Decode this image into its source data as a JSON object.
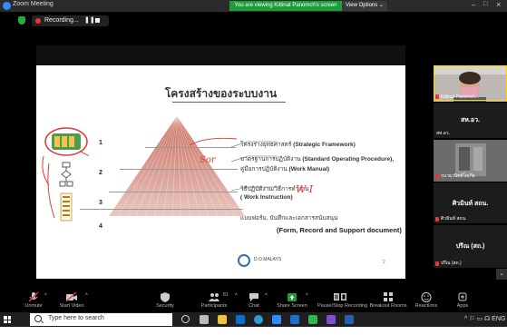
{
  "window": {
    "title": "Zoom Meeting",
    "share_banner": "You are viewing Kittinat Panomch's screen",
    "view_options": "View Options ⌄"
  },
  "recording": {
    "label": "Recording...",
    "pause": "❚❚",
    "stop": "■"
  },
  "slide": {
    "title": "โครงสร้างของระบบงาน",
    "levels": [
      "1",
      "2",
      "3",
      "4"
    ],
    "items": [
      {
        "thai": "โครงร่างยุทธศาสตร์ ",
        "en": "(Strategic Framework)"
      },
      {
        "thai": "มาตรฐานการปฏิบัติงาน ",
        "en": "(Standard Operating Procedure),"
      },
      {
        "thai": "คู่มือการปฏิบัติงาน ",
        "en": "(Work Manual)"
      },
      {
        "thai": "วิธีปฏิบัติงาน/วิธีการทำงาน",
        "en": ""
      },
      {
        "thai": "",
        "en": "( Work Instruction)"
      },
      {
        "thai": "แบบฟอร์ม, บันทึกและเอกสารสนับสนุน",
        "en": ""
      }
    ],
    "doc_line": "(Form, Record and Support document)",
    "annotations": [
      "Sor",
      "W I"
    ],
    "logo_text": "D.O.MALAYS",
    "page": "2"
  },
  "gallery": {
    "tiles": [
      {
        "type": "video",
        "label": "Kittinat Panomch...",
        "active": true,
        "muted": true
      },
      {
        "type": "name",
        "name": "สห.อว.",
        "label": "สห.อว."
      },
      {
        "type": "video",
        "label": "รนาธุวนิตย์โอเกีย",
        "muted": true
      },
      {
        "type": "name",
        "name": "ศิวมินท์ สถน.",
        "label": "ศิวมินท์ สถน.",
        "muted": true
      },
      {
        "type": "name",
        "name": "ปรีณ (สถ.)",
        "label": "ปรีณ (สถ.)",
        "muted": true
      }
    ],
    "collapse": "⌄"
  },
  "toolbar": {
    "items": [
      {
        "key": "unmute",
        "label": "Unmute"
      },
      {
        "key": "start_video",
        "label": "Start Video"
      },
      {
        "key": "security",
        "label": "Security"
      },
      {
        "key": "participants",
        "label": "Participants",
        "count": "81"
      },
      {
        "key": "chat",
        "label": "Chat"
      },
      {
        "key": "share_screen",
        "label": "Share Screen"
      },
      {
        "key": "record",
        "label": "Pause/Stop Recording"
      },
      {
        "key": "breakout",
        "label": "Breakout Rooms"
      },
      {
        "key": "reactions",
        "label": "Reactions"
      },
      {
        "key": "apps",
        "label": "Apps"
      }
    ],
    "colors": {
      "share": "#1f9d3a",
      "muted": "#e53935"
    }
  },
  "taskbar": {
    "search_placeholder": "Type here to search",
    "tray": "^ ⚐ ▭ ☊ ENG"
  }
}
